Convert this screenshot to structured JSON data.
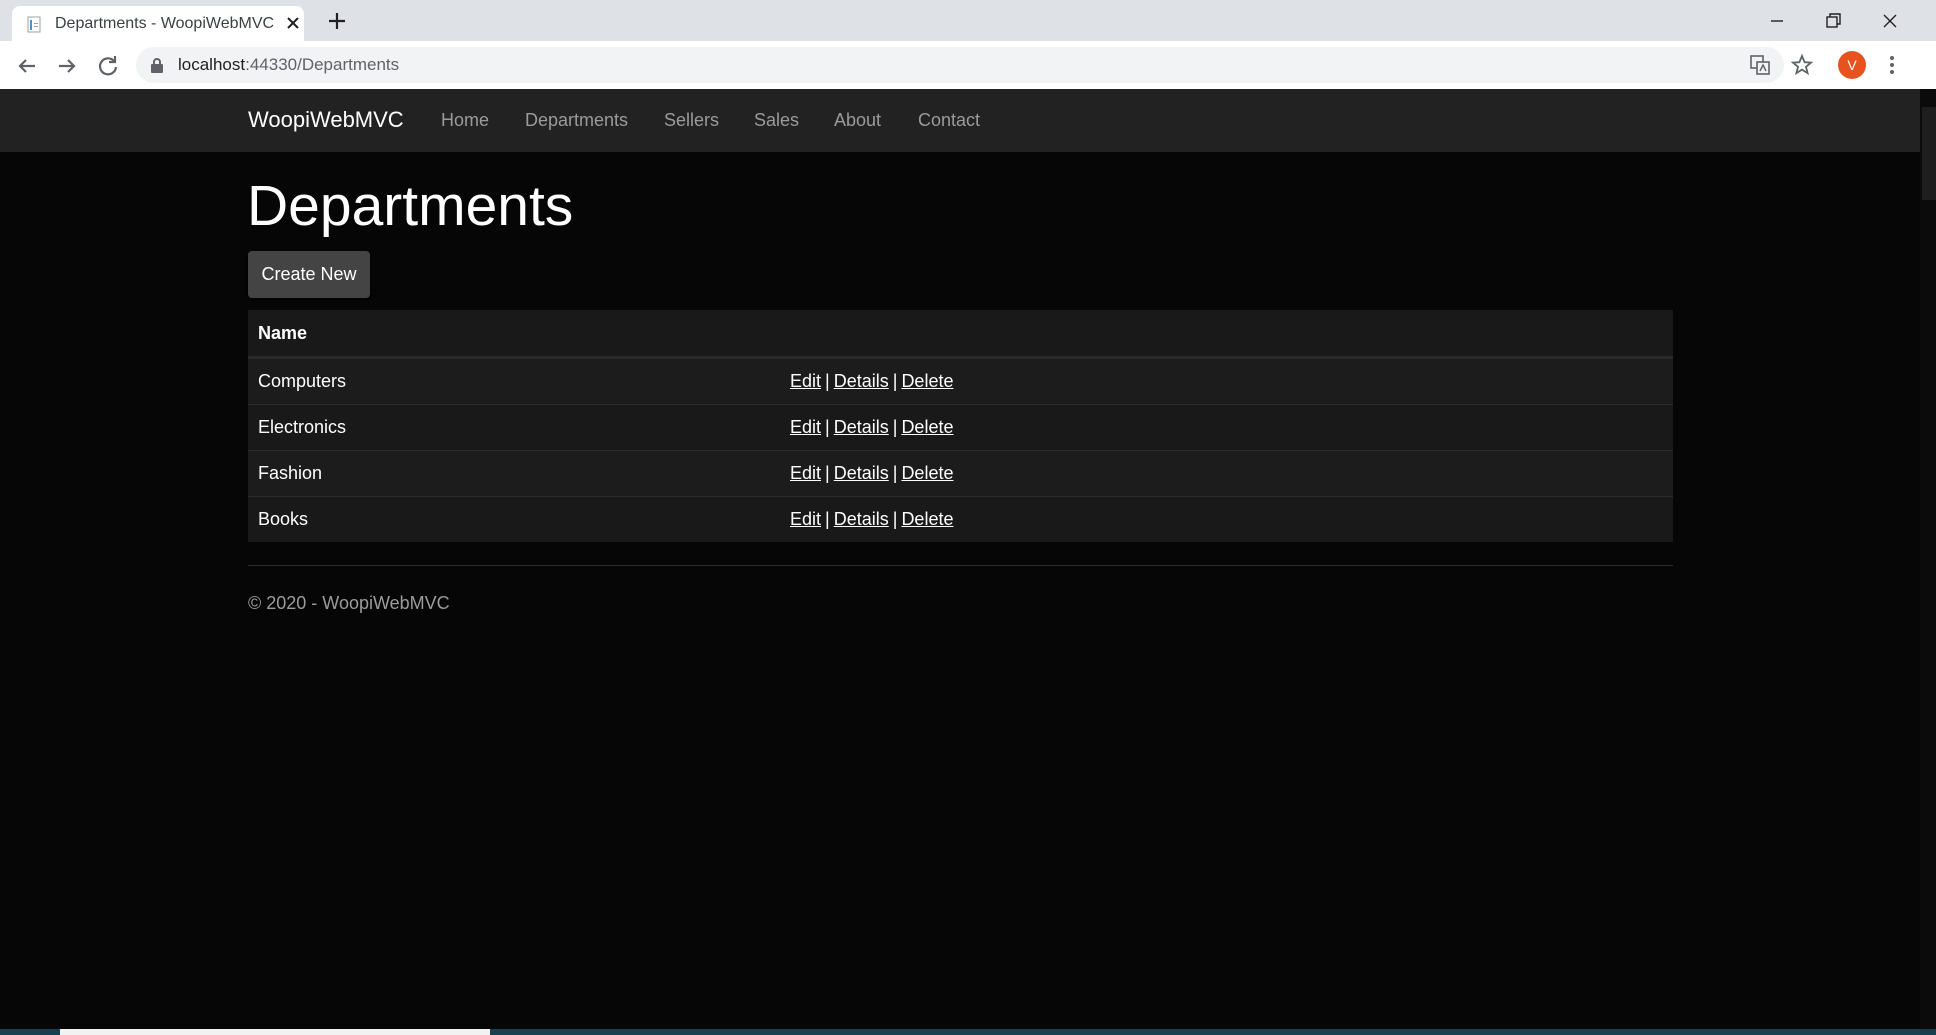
{
  "browser": {
    "tab_title": "Departments - WoopiWebMVC",
    "url_host": "localhost",
    "url_path": ":44330/Departments",
    "profile_initial": "V"
  },
  "site": {
    "brand": "WoopiWebMVC",
    "nav": [
      "Home",
      "Departments",
      "Sellers",
      "Sales",
      "About",
      "Contact"
    ]
  },
  "page": {
    "title": "Departments",
    "create_label": "Create New",
    "table_header": "Name",
    "rows": [
      {
        "name": "Computers"
      },
      {
        "name": "Electronics"
      },
      {
        "name": "Fashion"
      },
      {
        "name": "Books"
      }
    ],
    "actions": {
      "edit": "Edit",
      "details": "Details",
      "delete": "Delete",
      "separator": "|"
    }
  },
  "footer": "© 2020 - WoopiWebMVC",
  "colors": {
    "background": "#060606",
    "navbar": "#222222",
    "table": "#191919",
    "button": "#444444",
    "avatar": "#e8521f"
  }
}
